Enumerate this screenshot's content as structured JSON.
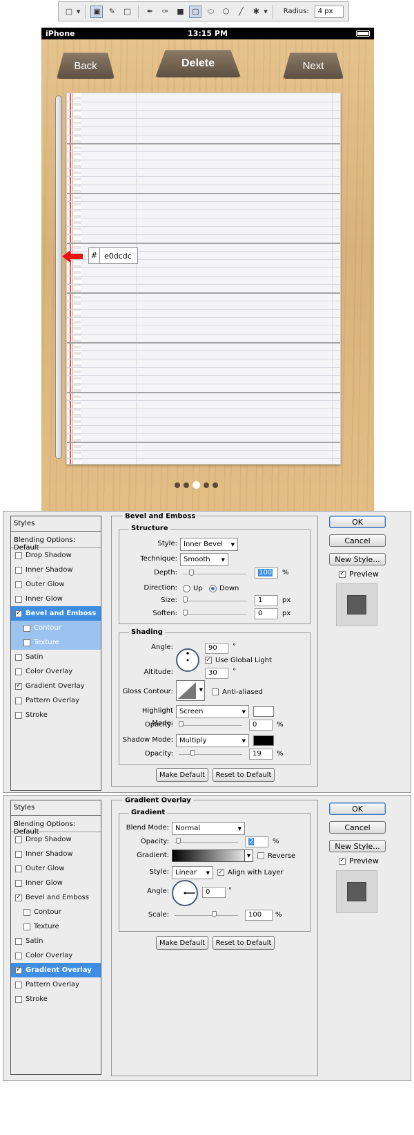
{
  "toolbar": {
    "radius_label": "Radius:",
    "radius_value": "4 px"
  },
  "iphone": {
    "carrier": "iPhone",
    "time": "13:15 PM",
    "back": "Back",
    "delete": "Delete",
    "next": "Next",
    "color_hash": "#",
    "color_hex": "e0dcdc",
    "page_dots": 5,
    "active_dot": 3
  },
  "dialog1": {
    "styles_header": "Styles",
    "blending": "Blending Options: Default",
    "items": [
      {
        "label": "Drop Shadow",
        "checked": false
      },
      {
        "label": "Inner Shadow",
        "checked": false
      },
      {
        "label": "Outer Glow",
        "checked": false
      },
      {
        "label": "Inner Glow",
        "checked": false
      },
      {
        "label": "Bevel and Emboss",
        "checked": true,
        "selected": true
      },
      {
        "label": "Contour",
        "checked": false,
        "sub": true
      },
      {
        "label": "Texture",
        "checked": false,
        "sub": true
      },
      {
        "label": "Satin",
        "checked": false
      },
      {
        "label": "Color Overlay",
        "checked": false
      },
      {
        "label": "Gradient Overlay",
        "checked": true
      },
      {
        "label": "Pattern Overlay",
        "checked": false
      },
      {
        "label": "Stroke",
        "checked": false
      }
    ],
    "panel_title": "Bevel and Emboss",
    "structure_title": "Structure",
    "style_label": "Style:",
    "style_value": "Inner Bevel",
    "technique_label": "Technique:",
    "technique_value": "Smooth",
    "depth_label": "Depth:",
    "depth_value": "100",
    "depth_pct": 100,
    "pct": "%",
    "direction_label": "Direction:",
    "dir_up": "Up",
    "dir_down": "Down",
    "size_label": "Size:",
    "size_value": "1",
    "px": "px",
    "soften_label": "Soften:",
    "soften_value": "0",
    "shading_title": "Shading",
    "angle_label": "Angle:",
    "angle_value": "90",
    "deg": "°",
    "global_light": "Use Global Light",
    "altitude_label": "Altitude:",
    "altitude_value": "30",
    "gloss_label": "Gloss Contour:",
    "anti_aliased": "Anti-aliased",
    "highlight_label": "Highlight Mode:",
    "highlight_value": "Screen",
    "highlight_color": "#ffffff",
    "opacity_label": "Opacity:",
    "highlight_opacity": "0",
    "shadow_label": "Shadow Mode:",
    "shadow_value": "Multiply",
    "shadow_color": "#000000",
    "shadow_opacity": "19",
    "make_default": "Make Default",
    "reset_default": "Reset to Default",
    "ok": "OK",
    "cancel": "Cancel",
    "new_style": "New Style...",
    "preview": "Preview"
  },
  "dialog2": {
    "styles_header": "Styles",
    "blending": "Blending Options: Default",
    "items": [
      {
        "label": "Drop Shadow",
        "checked": false
      },
      {
        "label": "Inner Shadow",
        "checked": false
      },
      {
        "label": "Outer Glow",
        "checked": false
      },
      {
        "label": "Inner Glow",
        "checked": false
      },
      {
        "label": "Bevel and Emboss",
        "checked": true
      },
      {
        "label": "Contour",
        "checked": false,
        "sub": true
      },
      {
        "label": "Texture",
        "checked": false,
        "sub": true
      },
      {
        "label": "Satin",
        "checked": false
      },
      {
        "label": "Color Overlay",
        "checked": false
      },
      {
        "label": "Gradient Overlay",
        "checked": true,
        "selected": true
      },
      {
        "label": "Pattern Overlay",
        "checked": false
      },
      {
        "label": "Stroke",
        "checked": false
      }
    ],
    "panel_title": "Gradient Overlay",
    "gradient_title": "Gradient",
    "blend_label": "Blend Mode:",
    "blend_value": "Normal",
    "opacity_label": "Opacity:",
    "opacity_value": "2",
    "pct": "%",
    "gradient_label": "Gradient:",
    "reverse": "Reverse",
    "style_label": "Style:",
    "style_value": "Linear",
    "align": "Align with Layer",
    "angle_label": "Angle:",
    "angle_value": "0",
    "deg": "°",
    "scale_label": "Scale:",
    "scale_value": "100",
    "make_default": "Make Default",
    "reset_default": "Reset to Default",
    "ok": "OK",
    "cancel": "Cancel",
    "new_style": "New Style...",
    "preview": "Preview"
  }
}
